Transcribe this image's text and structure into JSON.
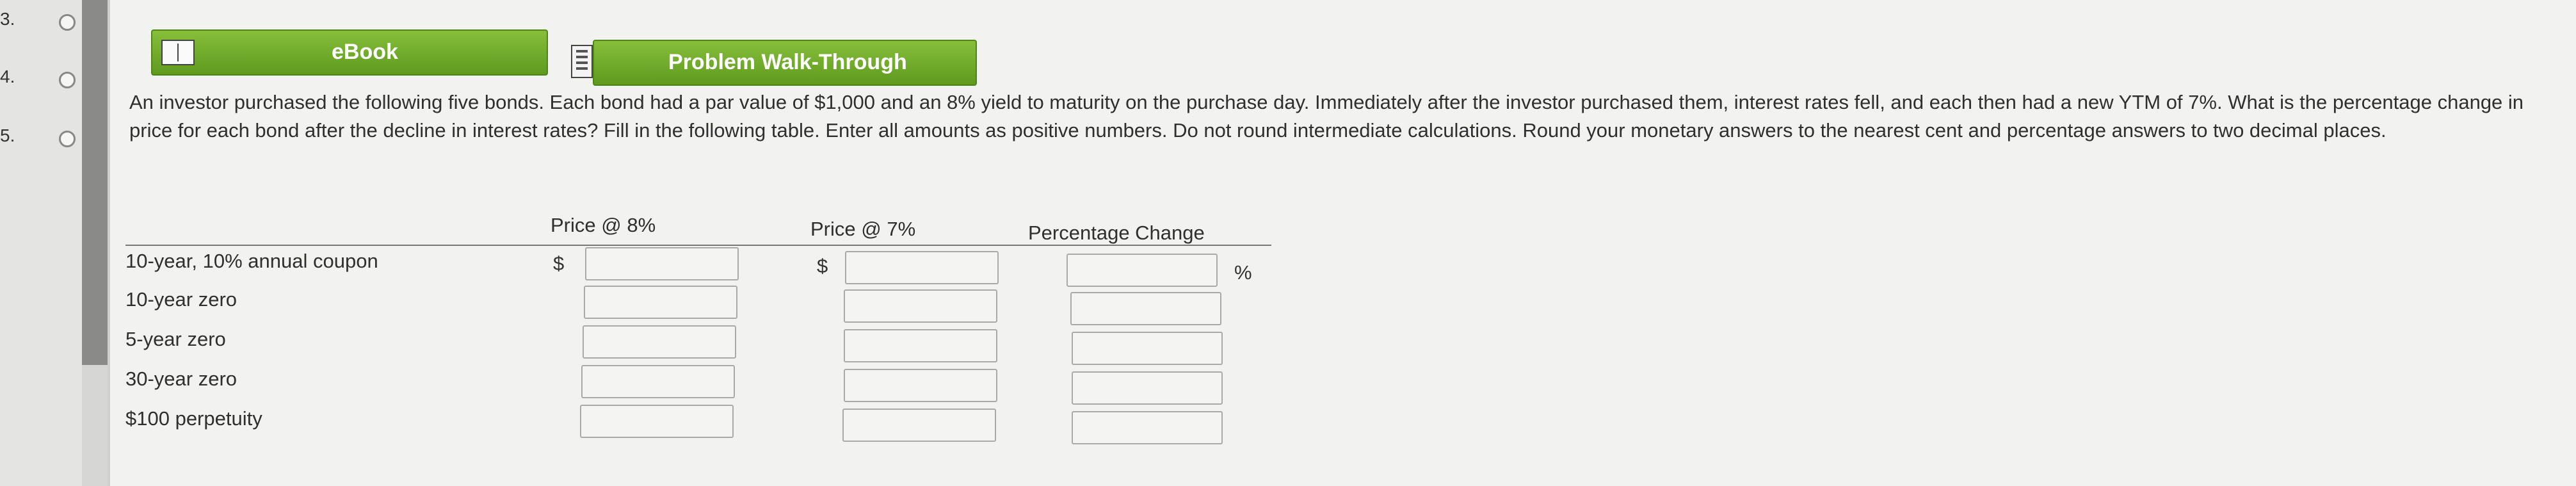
{
  "nav": {
    "questions": [
      {
        "num": "3."
      },
      {
        "num": "4."
      },
      {
        "num": "5."
      }
    ]
  },
  "toolbar": {
    "ebook_label": "eBook",
    "walkthrough_label": "Problem Walk-Through"
  },
  "question": {
    "text": "An investor purchased the following five bonds. Each bond had a par value of $1,000 and an 8% yield to maturity on the purchase day. Immediately after the investor purchased them, interest rates fell, and each then had a new YTM of 7%. What is the percentage change in price for each bond after the decline in interest rates? Fill in the following table. Enter all amounts as positive numbers. Do not round intermediate calculations. Round your monetary answers to the nearest cent and percentage answers to two decimal places."
  },
  "table": {
    "headers": {
      "price_8": "Price @ 8%",
      "price_7": "Price @ 7%",
      "pct_change": "Percentage Change"
    },
    "currency_symbol": "$",
    "percent_symbol": "%",
    "rows": [
      {
        "label": "10-year, 10% annual coupon",
        "price_8": "",
        "price_7": "",
        "pct_change": ""
      },
      {
        "label": "10-year zero",
        "price_8": "",
        "price_7": "",
        "pct_change": ""
      },
      {
        "label": "5-year zero",
        "price_8": "",
        "price_7": "",
        "pct_change": ""
      },
      {
        "label": "30-year zero",
        "price_8": "",
        "price_7": "",
        "pct_change": ""
      },
      {
        "label": "$100 perpetuity",
        "price_8": "",
        "price_7": "",
        "pct_change": ""
      }
    ]
  },
  "colors": {
    "button_green": "#6fa82a",
    "background": "#f2f2f0"
  }
}
